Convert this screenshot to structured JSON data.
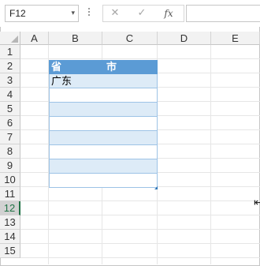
{
  "formula_bar": {
    "name_box": "F12",
    "name_box_caret": "▾",
    "cancel_glyph": "✕",
    "enter_glyph": "✓",
    "fx_label": "fx",
    "formula_value": ""
  },
  "columns": [
    "A",
    "B",
    "C",
    "D",
    "E"
  ],
  "rows": [
    "1",
    "2",
    "3",
    "4",
    "5",
    "6",
    "7",
    "8",
    "9",
    "10",
    "11",
    "12",
    "13",
    "14",
    "15"
  ],
  "selected_row": "12",
  "table": {
    "headers": [
      "省",
      "市"
    ],
    "rows": [
      [
        "广东",
        ""
      ],
      [
        "",
        ""
      ],
      [
        "",
        ""
      ],
      [
        "",
        ""
      ],
      [
        "",
        ""
      ],
      [
        "",
        ""
      ],
      [
        "",
        ""
      ],
      [
        "",
        ""
      ]
    ],
    "header_color": "#5b9bd5",
    "band_color": "#ddebf7"
  },
  "cursor_icon": "pointer-cursor-icon"
}
